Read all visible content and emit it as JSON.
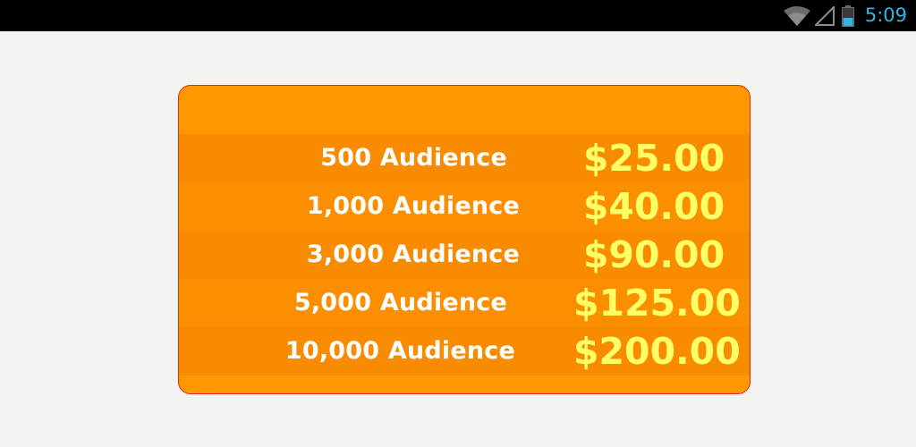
{
  "status_bar": {
    "time": "5:09",
    "icons": [
      "wifi-icon",
      "signal-icon",
      "battery-icon"
    ],
    "clock_color": "#33b5e5"
  },
  "pricing": {
    "colors": {
      "card_background": "#ff9800",
      "card_border": "#e8261a",
      "label_text": "#ffffff",
      "price_text": "#ffff66"
    },
    "rows": [
      {
        "audience": "500 Audience",
        "price": "$25.00"
      },
      {
        "audience": "1,000 Audience",
        "price": "$40.00"
      },
      {
        "audience": "3,000 Audience",
        "price": "$90.00"
      },
      {
        "audience": "5,000 Audience",
        "price": "$125.00"
      },
      {
        "audience": "10,000 Audience",
        "price": "$200.00"
      }
    ]
  }
}
